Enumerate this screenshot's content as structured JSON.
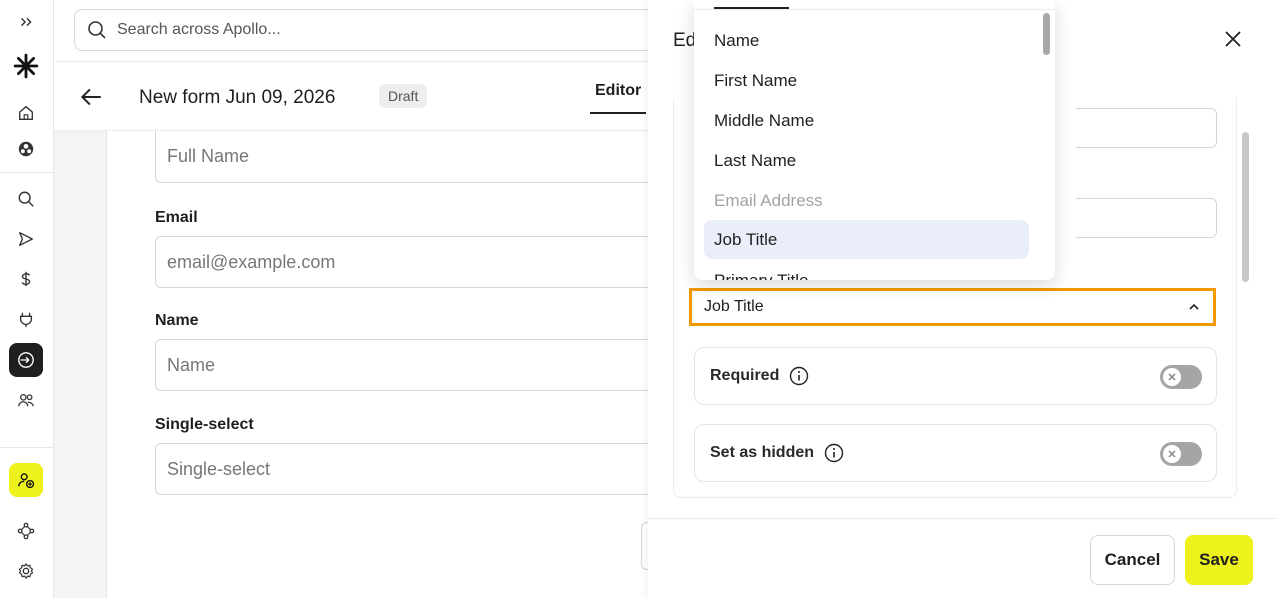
{
  "sidebar": {
    "icons": [
      "expand-icon",
      "logo-icon",
      "home-icon",
      "globe-icon",
      "search-icon",
      "send-icon",
      "dollar-icon",
      "plug-icon",
      "form-icon",
      "people-icon",
      "add-contact-icon",
      "workflow-icon",
      "settings-icon"
    ]
  },
  "search": {
    "placeholder": "Search across Apollo..."
  },
  "header": {
    "title": "New form Jun 09, 2026",
    "badge": "Draft",
    "tab": "Editor"
  },
  "form": {
    "fields": [
      {
        "label": "",
        "placeholder": "Full Name"
      },
      {
        "label": "Email",
        "placeholder": "email@example.com"
      },
      {
        "label": "Name",
        "placeholder": "Name"
      },
      {
        "label": "Single-select",
        "placeholder": "Single-select"
      }
    ]
  },
  "panel": {
    "title": "Ed",
    "select_value": "Job Title",
    "required_label": "Required",
    "hidden_label": "Set as hidden",
    "cancel_label": "Cancel",
    "save_label": "Save"
  },
  "dropdown": {
    "options": [
      {
        "label": "Name",
        "state": "normal"
      },
      {
        "label": "First Name",
        "state": "normal"
      },
      {
        "label": "Middle Name",
        "state": "normal"
      },
      {
        "label": "Last Name",
        "state": "normal"
      },
      {
        "label": "Email Address",
        "state": "disabled"
      },
      {
        "label": "Job Title",
        "state": "selected"
      },
      {
        "label": "Primary Title",
        "state": "normal"
      }
    ]
  },
  "colors": {
    "accent": "#eef21c",
    "focus": "#f29a00",
    "active_nav": "#1f1f1f"
  }
}
